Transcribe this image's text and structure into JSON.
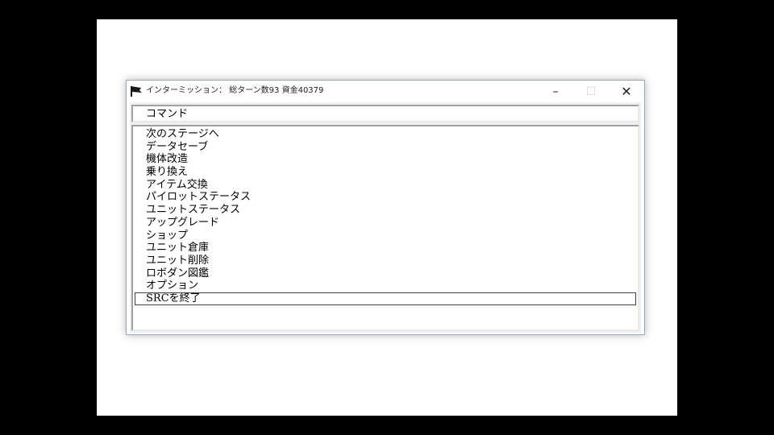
{
  "window": {
    "title": "インターミッション： 総ターン数93 資金40379",
    "minimize_glyph": "–",
    "maximize_glyph": "☐",
    "close_glyph": "✕",
    "app_icon": "flag-icon"
  },
  "header": {
    "label": "コマンド"
  },
  "menu": {
    "items": [
      "次のステージへ",
      "データセーブ",
      "機体改造",
      "乗り換え",
      "アイテム交換",
      "パイロットステータス",
      "ユニットステータス",
      "アップグレード",
      "ショップ",
      "ユニット倉庫",
      "ユニット削除",
      "ロボダン図鑑",
      "オプション",
      "SRCを終了"
    ],
    "selected_item": "SRCを終了"
  },
  "colors": {
    "frame": "#8fa8c8",
    "client_bg": "#f0f0f0"
  }
}
